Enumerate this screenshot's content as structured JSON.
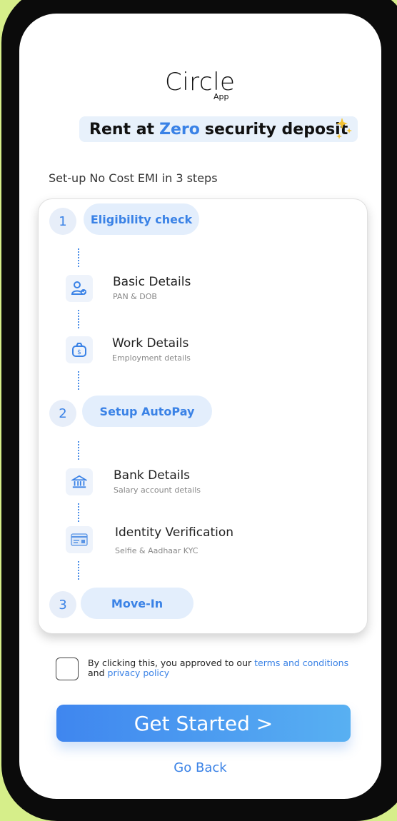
{
  "brand": {
    "name": "Circle",
    "sub": "App"
  },
  "tagline": {
    "prefix": "Rent at",
    "highlight": "Zero",
    "suffix": "security deposit"
  },
  "steps_title": "Set-up No Cost EMI in 3 steps",
  "steps": [
    {
      "number": "1",
      "label": "Eligibility check",
      "items": [
        {
          "title": "Basic Details",
          "subtitle": "PAN & DOB",
          "icon": "user-check-icon"
        },
        {
          "title": "Work Details",
          "subtitle": "Employment details",
          "icon": "money-bag-icon"
        }
      ]
    },
    {
      "number": "2",
      "label": "Setup AutoPay",
      "items": [
        {
          "title": "Bank Details",
          "subtitle": "Salary account details",
          "icon": "bank-icon"
        },
        {
          "title": "Identity Verification",
          "subtitle": "Selfie & Aadhaar KYC",
          "icon": "id-card-icon"
        }
      ]
    },
    {
      "number": "3",
      "label": "Move-In",
      "items": []
    }
  ],
  "consent": {
    "text": "By clicking this, you approved to our",
    "terms_link": "terms and conditions",
    "and": "and",
    "privacy_link": "privacy policy"
  },
  "cta_label": "Get Started >",
  "back_label": "Go Back",
  "colors": {
    "accent": "#3a82e6",
    "background": "#d6ee8a",
    "frame": "#0b0b0b"
  }
}
